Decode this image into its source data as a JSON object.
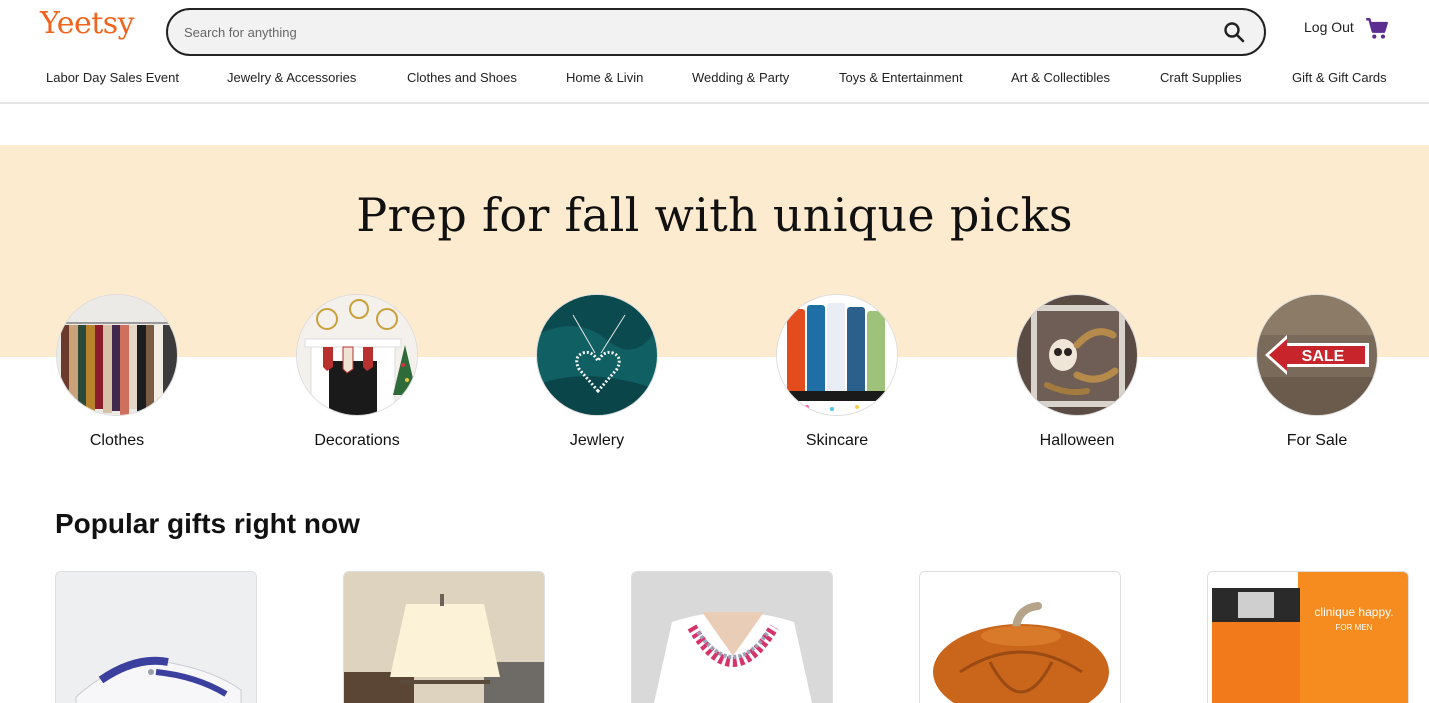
{
  "brand": {
    "logo": "Yeetsy",
    "color": "#f1641e"
  },
  "search": {
    "placeholder": "Search for anything",
    "icon": "search-icon"
  },
  "account": {
    "logout_label": "Log Out",
    "cart_icon": "cart-icon",
    "cart_color": "#5c2d91"
  },
  "categories": [
    "Labor Day Sales Event",
    "Jewelry & Accessories",
    "Clothes and Shoes",
    "Home & Livin",
    "Wedding & Party",
    "Toys & Entertainment",
    "Art & Collectibles",
    "Craft Supplies",
    "Gift & Gift Cards"
  ],
  "hero": {
    "title": "Prep for fall with unique picks",
    "band_color": "#fdebcf",
    "circles": [
      {
        "label": "Clothes"
      },
      {
        "label": "Decorations"
      },
      {
        "label": "Jewlery"
      },
      {
        "label": "Skincare"
      },
      {
        "label": "Halloween"
      },
      {
        "label": "For Sale"
      }
    ]
  },
  "popular": {
    "title": "Popular gifts right now",
    "products": [
      {
        "name": "sneaker"
      },
      {
        "name": "wall-lamp"
      },
      {
        "name": "beaded-necklace"
      },
      {
        "name": "pumpkin-cocotte"
      },
      {
        "name": "clinique-happy-for-men",
        "text_line1": "clinique happy.",
        "text_line2": "FOR MEN"
      }
    ]
  }
}
